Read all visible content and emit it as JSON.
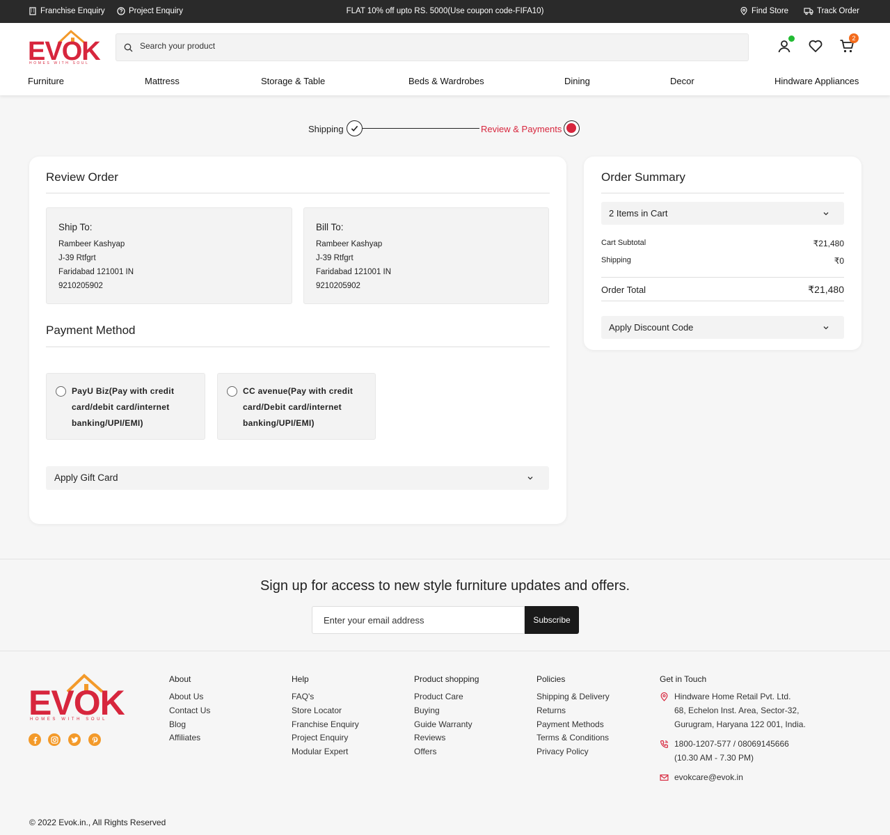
{
  "topbar": {
    "franchise": "Franchise Enquiry",
    "project": "Project Enquiry",
    "promo": "FLAT 10% off upto RS. 5000(Use coupon code-FIFA10)",
    "find_store": "Find Store",
    "track_order": "Track Order"
  },
  "brand": {
    "logo": "EVOK",
    "tagline": "HOMES WITH SOUL",
    "color": "#d7263d"
  },
  "search": {
    "placeholder": "Search your product"
  },
  "cart": {
    "count": "2"
  },
  "nav": [
    "Furniture",
    "Mattress",
    "Storage & Table",
    "Beds & Wardrobes",
    "Dining",
    "Decor",
    "Hindware Appliances"
  ],
  "steps": {
    "shipping": "Shipping",
    "review": "Review & Payments",
    "active_color": "#d7263d"
  },
  "review": {
    "title": "Review Order",
    "ship_title": "Ship To:",
    "ship_lines": [
      "Rambeer Kashyap",
      "J-39 Rtfgrt",
      "Faridabad 121001 IN",
      "9210205902"
    ],
    "bill_title": "Bill To:",
    "bill_lines": [
      "Rambeer Kashyap",
      "J-39 Rtfgrt",
      "Faridabad 121001 IN",
      "9210205902"
    ],
    "payment_title": "Payment Method",
    "payu": "PayU Biz(Pay with credit card/debit card/internet banking/UPI/EMI)",
    "ccavenue": "CC avenue(Pay with credit card/Debit card/internet banking/UPI/EMI)",
    "gift_card": "Apply Gift Card"
  },
  "summary": {
    "title": "Order Summary",
    "items": "2 Items in Cart",
    "subtotal_label": "Cart Subtotal",
    "subtotal_value": "₹21,480",
    "shipping_label": "Shipping",
    "shipping_value": "₹0",
    "total_label": "Order Total",
    "total_value": "₹21,480",
    "discount": "Apply Discount Code"
  },
  "newsletter": {
    "heading": "Sign up for access to new style furniture updates and offers.",
    "placeholder": "Enter your email address",
    "button": "Subscribe"
  },
  "footer": {
    "about": {
      "title": "About",
      "links": [
        "About Us",
        "Contact Us",
        "Blog",
        "Affiliates"
      ]
    },
    "help": {
      "title": "Help",
      "links": [
        "FAQ's",
        "Store Locator",
        "Franchise Enquiry",
        "Project Enquiry",
        "Modular Expert"
      ]
    },
    "shopping": {
      "title": "Product shopping",
      "links": [
        "Product Care",
        "Buying",
        "Guide Warranty",
        "Reviews",
        "Offers"
      ]
    },
    "policies": {
      "title": "Policies",
      "links": [
        "Shipping & Delivery",
        "Returns",
        "Payment Methods",
        "Terms & Conditions",
        "Privacy Policy"
      ]
    },
    "contact": {
      "title": "Get in Touch",
      "address": [
        "Hindware Home Retail Pvt. Ltd.",
        "68, Echelon Inst. Area, Sector-32,",
        "Gurugram, Haryana 122 001, India."
      ],
      "phone": [
        "1800-1207-577 / 08069145666",
        "(10.30 AM - 7.30 PM)"
      ],
      "email": "evokcare@evok.in"
    },
    "copyright": "© 2022 Evok.in., All Rights Reserved"
  }
}
